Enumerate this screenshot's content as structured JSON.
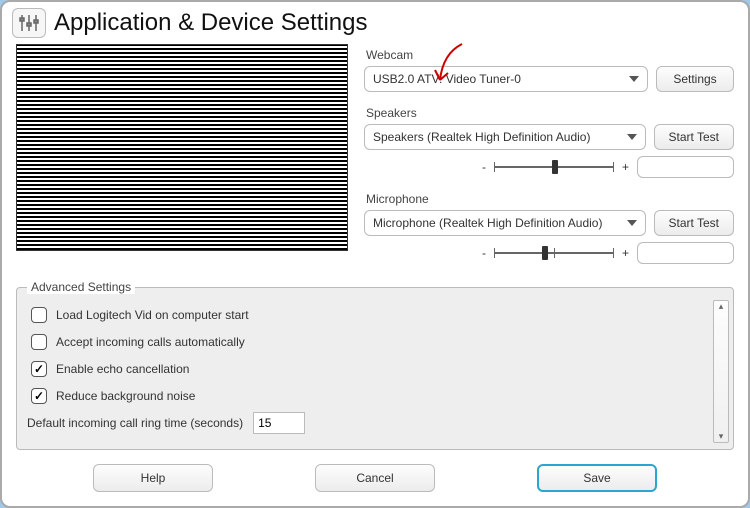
{
  "title": "Application & Device Settings",
  "webcam": {
    "label": "Webcam",
    "value": "USB2.0 ATV: Video Tuner-0",
    "button": "Settings"
  },
  "speakers": {
    "label": "Speakers",
    "value": "Speakers (Realtek High Definition Audio)",
    "button": "Start Test"
  },
  "mic": {
    "label": "Microphone",
    "value": "Microphone (Realtek High Definition Audio)",
    "button": "Start Test"
  },
  "slider_minus": "-",
  "slider_plus": "+",
  "adv": {
    "legend": "Advanced Settings",
    "opt1": {
      "label": "Load Logitech Vid on computer start",
      "checked": false
    },
    "opt2": {
      "label": "Accept incoming calls automatically",
      "checked": false
    },
    "opt3": {
      "label": "Enable echo cancellation",
      "checked": true
    },
    "opt4": {
      "label": "Reduce background noise",
      "checked": true
    },
    "ring": {
      "label": "Default incoming call ring time (seconds)",
      "value": "15"
    }
  },
  "buttons": {
    "help": "Help",
    "cancel": "Cancel",
    "save": "Save"
  }
}
